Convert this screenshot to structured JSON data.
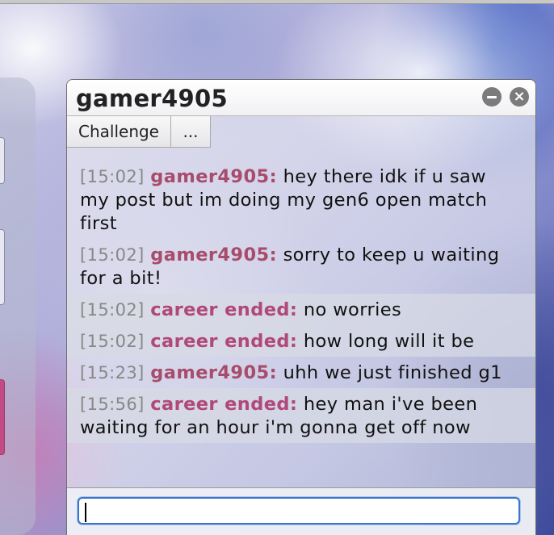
{
  "pm": {
    "title": "gamer4905",
    "toolbar": {
      "challenge_label": "Challenge",
      "more_label": "..."
    },
    "messages": [
      {
        "time": "[15:02]",
        "user": "gamer4905:",
        "text": "hey there idk if u saw my post but im doing my gen6 open match first"
      },
      {
        "time": "[15:02]",
        "user": "gamer4905:",
        "text": "sorry to keep u waiting for a bit!"
      },
      {
        "time": "[15:02]",
        "user": "career ended:",
        "text": "no worries"
      },
      {
        "time": "[15:02]",
        "user": "career ended:",
        "text": "how long will it be"
      },
      {
        "time": "[15:23]",
        "user": "gamer4905:",
        "text": "uhh we just finished g1"
      },
      {
        "time": "[15:56]",
        "user": "career ended:",
        "text": "hey man i've been waiting for an hour i'm gonna get off now"
      }
    ],
    "input": {
      "value": "",
      "placeholder": ""
    }
  },
  "icons": {
    "minimize": "minimize-icon",
    "close": "close-icon"
  },
  "colors": {
    "username": "#b0487a",
    "timestamp": "#888888",
    "input_focus": "#3b75c8"
  }
}
